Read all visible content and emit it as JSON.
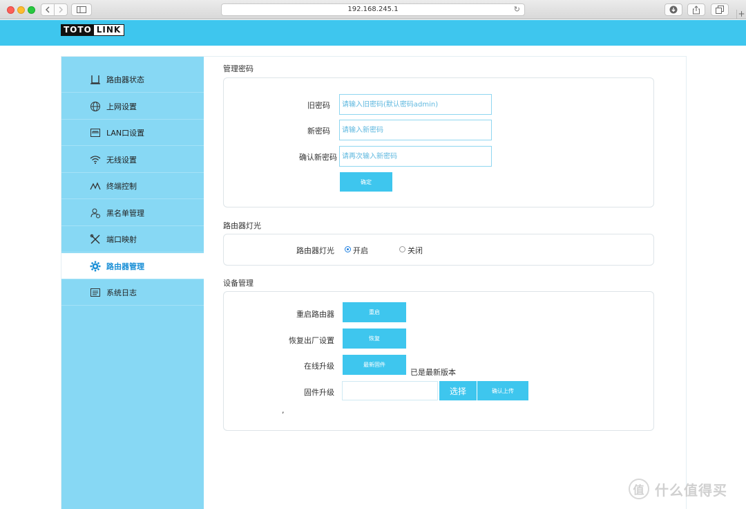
{
  "browser": {
    "url": "192.168.245.1",
    "reload_icon": "↻",
    "plus": "+"
  },
  "header": {
    "logo_part1": "TOTO",
    "logo_part2": "LINK",
    "accent": "#3ec6ee"
  },
  "sidebar": {
    "items": [
      {
        "label": "路由器状态",
        "icon": "router-icon"
      },
      {
        "label": "上网设置",
        "icon": "globe-icon"
      },
      {
        "label": "LAN口设置",
        "icon": "lan-port-icon"
      },
      {
        "label": "无线设置",
        "icon": "wifi-icon"
      },
      {
        "label": "终端控制",
        "icon": "activity-icon"
      },
      {
        "label": "黑名单管理",
        "icon": "user-block-icon"
      },
      {
        "label": "端口映射",
        "icon": "tools-icon"
      },
      {
        "label": "路由器管理",
        "icon": "gear-icon",
        "active": true
      },
      {
        "label": "系统日志",
        "icon": "log-icon"
      }
    ]
  },
  "password": {
    "title": "管理密码",
    "old_label": "旧密码",
    "old_placeholder": "请输入旧密码(默认密码admin)",
    "new_label": "新密码",
    "new_placeholder": "请输入新密码",
    "confirm_label": "确认新密码",
    "confirm_placeholder": "请再次输入新密码",
    "submit": "确定"
  },
  "light": {
    "title": "路由器灯光",
    "label": "路由器灯光",
    "on": "开启",
    "off": "关闭",
    "selected": "on"
  },
  "device": {
    "title": "设备管理",
    "reboot_label": "重启路由器",
    "reboot_btn": "重启",
    "reset_label": "恢复出厂设置",
    "reset_btn": "恢复",
    "online_label": "在线升级",
    "online_btn": "最新固件",
    "online_status": "已是最新版本",
    "firmware_label": "固件升级",
    "choose_btn": "选择",
    "upload_btn": "确认上传",
    "stray_mark": ","
  },
  "watermark": {
    "glyph": "值",
    "text": "什么值得买"
  }
}
